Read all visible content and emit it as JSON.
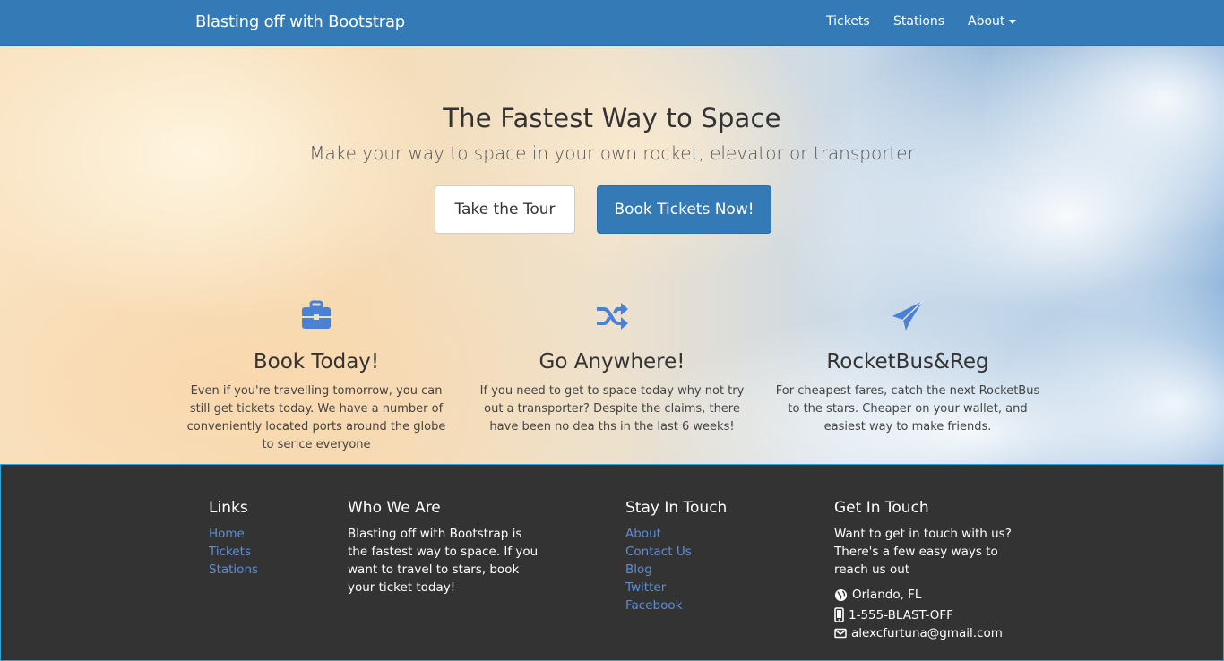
{
  "navbar": {
    "brand": "Blasting off with Bootstrap",
    "links": [
      "Tickets",
      "Stations",
      "About"
    ]
  },
  "hero": {
    "title": "The Fastest Way to Space",
    "subtitle": "Make your way to space in your own rocket, elevator or transporter",
    "tour_button": "Take the Tour",
    "book_button": "Book Tickets Now!"
  },
  "features": [
    {
      "icon": "briefcase-icon",
      "title": "Book Today!",
      "text": "Even if you're travelling tomorrow, you can still get tickets today. We have a number of conveniently located ports around the globe to serice everyone"
    },
    {
      "icon": "shuffle-icon",
      "title": "Go Anywhere!",
      "text": "If you need to get to space today why not try out a transporter? Despite the claims, there have been no dea ths in the last 6 weeks!"
    },
    {
      "icon": "paper-plane-icon",
      "title": "RocketBus&Reg",
      "text": "For cheapest fares, catch the next RocketBus to the stars. Cheaper on your wallet, and easiest way to make friends."
    }
  ],
  "footer": {
    "links": {
      "heading": "Links",
      "items": [
        "Home",
        "Tickets",
        "Stations"
      ]
    },
    "who": {
      "heading": "Who We Are",
      "text": "Blasting off with Bootstrap is the fastest way to space. If you want to travel to stars, book your ticket today!"
    },
    "stay": {
      "heading": "Stay In Touch",
      "items": [
        "About",
        "Contact Us",
        "Blog",
        "Twitter",
        "Facebook"
      ]
    },
    "get": {
      "heading": "Get In Touch",
      "text": "Want to get in touch with us? There's a few easy ways to reach us out",
      "location": "Orlando, FL",
      "phone": "1-555-BLAST-OFF",
      "email": "alexcfurtuna@gmail.com"
    }
  },
  "colors": {
    "primary": "#337ab7",
    "footer_bg": "#333333",
    "link": "#5b8ed8",
    "icon": "#4a80d6"
  }
}
